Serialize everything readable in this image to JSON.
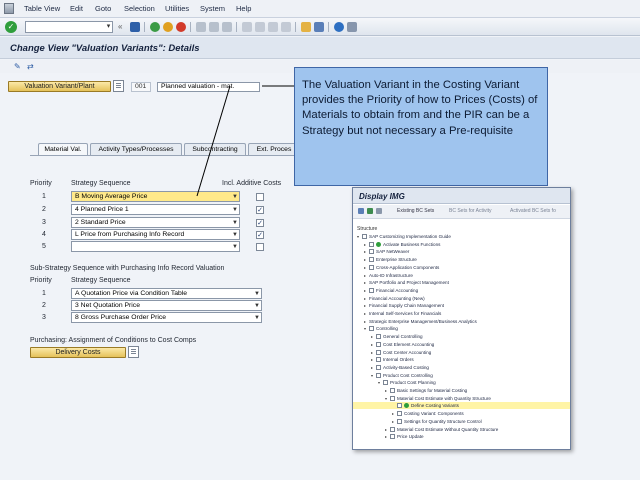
{
  "menu": [
    "Table View",
    "Edit",
    "Goto",
    "Selection",
    "Utilities",
    "System",
    "Help"
  ],
  "menu_underline": [
    "T",
    "E",
    "G",
    "S",
    "l",
    "y",
    "H"
  ],
  "title": "Change View \"Valuation Variants\": Details",
  "variant": {
    "button_label": "Valuation Variant/Plant",
    "code": "001",
    "description": "Planned valuation - mat."
  },
  "tabs": [
    "Material Val.",
    "Activity Types/Processes",
    "Subcontracting",
    "Ext. Proces"
  ],
  "material_valuation": {
    "priority_header": "Priority",
    "strategy_header": "Strategy Sequence",
    "additive_header": "Incl. Additive Costs",
    "rows": [
      {
        "priority": "1",
        "strategy": "B Moving Average Price",
        "checked": false,
        "selected": true
      },
      {
        "priority": "2",
        "strategy": "4 Planned Price 1",
        "checked": true,
        "selected": false
      },
      {
        "priority": "3",
        "strategy": "2 Standard Price",
        "checked": true,
        "selected": false
      },
      {
        "priority": "4",
        "strategy": "L Price from Purchasing Info Record",
        "checked": true,
        "selected": false
      },
      {
        "priority": "5",
        "strategy": "",
        "checked": false,
        "selected": false
      }
    ]
  },
  "sub_strategy": {
    "heading": "Sub-Strategy Sequence with Purchasing Info Record Valuation",
    "priority_header": "Priority",
    "strategy_header": "Strategy Sequence",
    "rows": [
      {
        "priority": "1",
        "strategy": "A Quotation Price via Condition Table"
      },
      {
        "priority": "2",
        "strategy": "3 Net Quotation Price"
      },
      {
        "priority": "3",
        "strategy": "8 Gross Purchase Order Price"
      }
    ]
  },
  "purchasing": {
    "heading": "Purchasing: Assignment of Conditions to Cost Comps",
    "button_label": "Delivery Costs"
  },
  "callout": {
    "text": "The Valuation Variant in the Costing Variant provides the Priority of how to Prices (Costs) of Materials to obtain from and the PIR can be a Strategy but not necessary a Pre-requisite"
  },
  "img_window": {
    "title": "Display IMG",
    "toolbar": [
      "Existing BC Sets",
      "BC Sets for Activity",
      "Activated BC Sets fo"
    ],
    "structure_label": "Structure",
    "tree": [
      {
        "label": "SAP Customizing Implementation Guide",
        "level": 0,
        "tri": "▾",
        "folder": true,
        "go": false
      },
      {
        "label": "Activate Business Functions",
        "level": 1,
        "tri": "▸",
        "folder": true,
        "go": true
      },
      {
        "label": "SAP NetWeaver",
        "level": 1,
        "tri": "▸",
        "folder": true,
        "go": false
      },
      {
        "label": "Enterprise Structure",
        "level": 1,
        "tri": "▸",
        "folder": true,
        "go": false
      },
      {
        "label": "Cross-Application Components",
        "level": 1,
        "tri": "▸",
        "folder": true,
        "go": false
      },
      {
        "label": "Auto-ID Infrastructure",
        "level": 1,
        "tri": "▸",
        "folder": false,
        "go": false
      },
      {
        "label": "SAP Portfolio and Project Management",
        "level": 1,
        "tri": "▸",
        "folder": false,
        "go": false
      },
      {
        "label": "Financial Accounting",
        "level": 1,
        "tri": "▸",
        "folder": true,
        "go": false
      },
      {
        "label": "Financial Accounting (New)",
        "level": 1,
        "tri": "▸",
        "folder": false,
        "go": false
      },
      {
        "label": "Financial Supply Chain Management",
        "level": 1,
        "tri": "▸",
        "folder": false,
        "go": false
      },
      {
        "label": "Internal Self-Services for Financials",
        "level": 1,
        "tri": "▸",
        "folder": false,
        "go": false
      },
      {
        "label": "Strategic Enterprise Management/Business Analytics",
        "level": 1,
        "tri": "▸",
        "folder": false,
        "go": false
      },
      {
        "label": "Controlling",
        "level": 1,
        "tri": "▾",
        "folder": true,
        "go": false
      },
      {
        "label": "General Controlling",
        "level": 2,
        "tri": "▸",
        "folder": true,
        "go": false
      },
      {
        "label": "Cost Element Accounting",
        "level": 2,
        "tri": "▸",
        "folder": true,
        "go": false
      },
      {
        "label": "Cost Center Accounting",
        "level": 2,
        "tri": "▸",
        "folder": true,
        "go": false
      },
      {
        "label": "Internal Orders",
        "level": 2,
        "tri": "▸",
        "folder": true,
        "go": false
      },
      {
        "label": "Activity-Based Costing",
        "level": 2,
        "tri": "▸",
        "folder": true,
        "go": false
      },
      {
        "label": "Product Cost Controlling",
        "level": 2,
        "tri": "▾",
        "folder": true,
        "go": false
      },
      {
        "label": "Product Cost Planning",
        "level": 3,
        "tri": "▾",
        "folder": true,
        "go": false
      },
      {
        "label": "Basic Settings for Material Costing",
        "level": 4,
        "tri": "▸",
        "folder": true,
        "go": false
      },
      {
        "label": "Material Cost Estimate with Quantity Structure",
        "level": 4,
        "tri": "▾",
        "folder": true,
        "go": false
      },
      {
        "label": "Define Costing Variants",
        "level": 5,
        "tri": "",
        "folder": true,
        "go": true,
        "highlight": true
      },
      {
        "label": "Costing Variant: Components",
        "level": 5,
        "tri": "▸",
        "folder": true,
        "go": false
      },
      {
        "label": "Settings for Quantity Structure Control",
        "level": 5,
        "tri": "▸",
        "folder": true,
        "go": false
      },
      {
        "label": "Material Cost Estimate Without Quantity Structure",
        "level": 4,
        "tri": "▸",
        "folder": true,
        "go": false
      },
      {
        "label": "Price Update",
        "level": 4,
        "tri": "▸",
        "folder": true,
        "go": false
      }
    ]
  },
  "colors": {
    "callout_bg": "#9fc4ee",
    "button_yellow": "#e5c25a",
    "selected_row": "#ffe98a",
    "tree_highlight": "#fff4a6"
  }
}
